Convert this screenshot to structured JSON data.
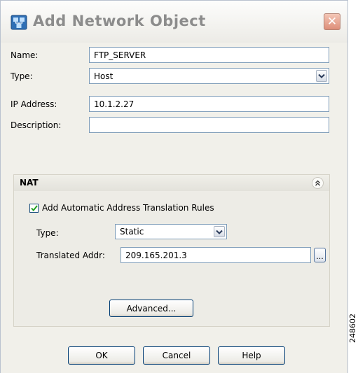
{
  "window": {
    "title": "Add Network Object",
    "title_icon": "network-object-icon",
    "close_icon": "close-icon"
  },
  "form": {
    "name_label": "Name:",
    "name_value": "FTP_SERVER",
    "type_label": "Type:",
    "type_value": "Host",
    "ip_label": "IP Address:",
    "ip_value": "10.1.2.27",
    "description_label": "Description:",
    "description_value": ""
  },
  "nat": {
    "title": "NAT",
    "collapse_icon": "double-chevron-up-icon",
    "auto_rules_label": "Add Automatic Address Translation Rules",
    "auto_rules_checked": true,
    "type_label": "Type:",
    "type_value": "Static",
    "translated_label": "Translated Addr:",
    "translated_value": "209.165.201.3",
    "browse_label": "...",
    "advanced_label": "Advanced..."
  },
  "buttons": {
    "ok": "OK",
    "cancel": "Cancel",
    "help": "Help"
  },
  "figure_id": "248602",
  "colors": {
    "dialog_bg": "#f1f0ea",
    "field_border": "#7f9db9",
    "button_border": "#003c74",
    "close_button": "#de8e79",
    "checkbox_check": "#21a121"
  }
}
